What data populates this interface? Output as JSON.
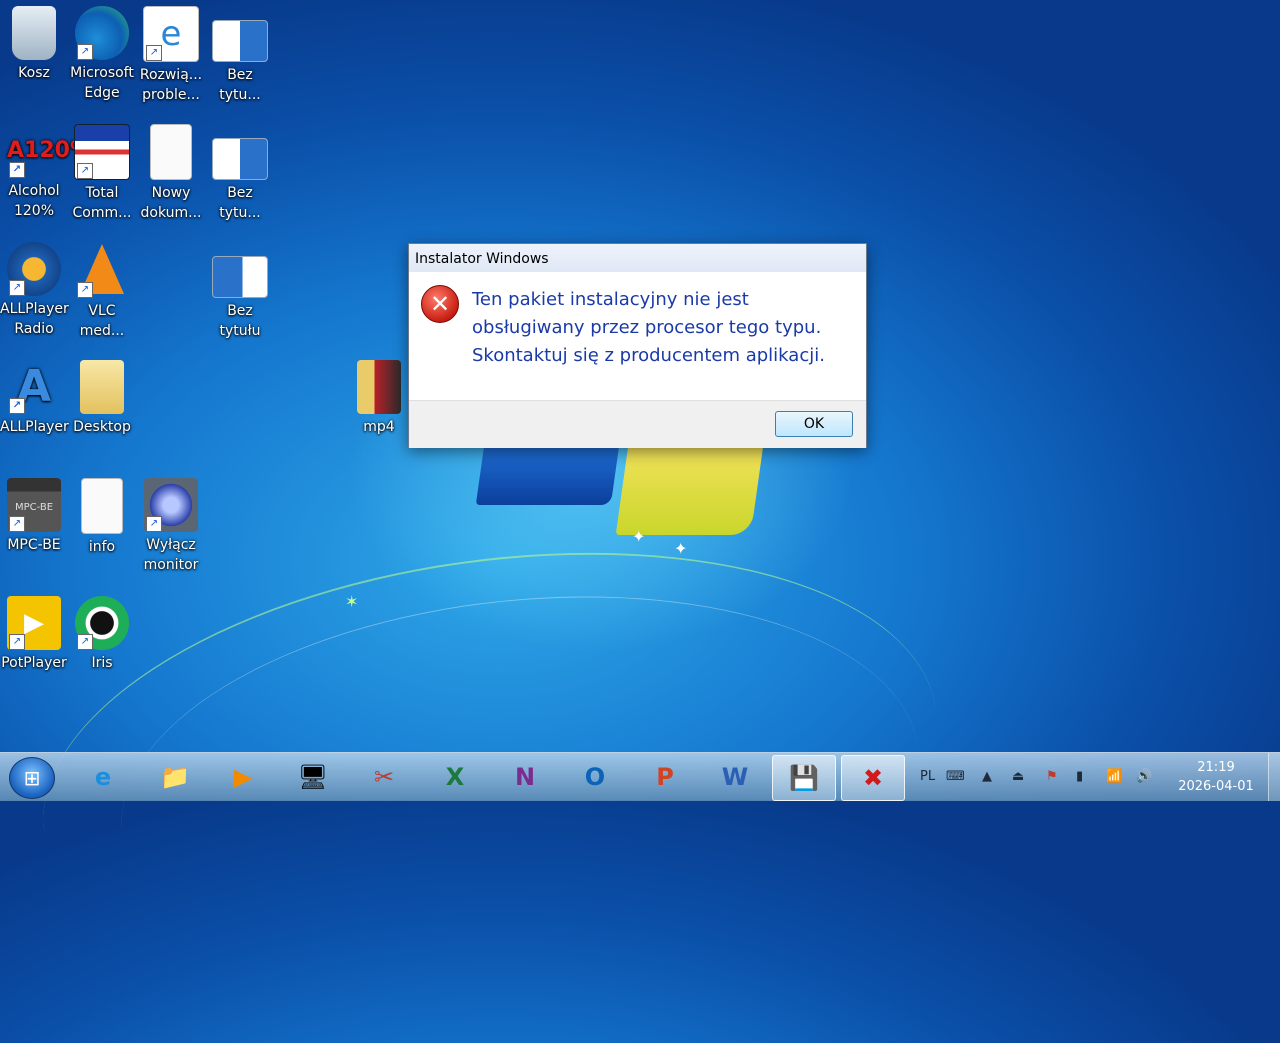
{
  "desktop": {
    "icons": [
      {
        "label": "Kosz"
      },
      {
        "label": "Microsoft Edge"
      },
      {
        "label": "Rozwią... proble..."
      },
      {
        "label": "Bez tytu..."
      },
      {
        "label": "Alcohol 120%"
      },
      {
        "label": "Total Comm..."
      },
      {
        "label": "Nowy dokum..."
      },
      {
        "label": "Bez tytu..."
      },
      {
        "label": "ALLPlayer Radio"
      },
      {
        "label": "VLC med..."
      },
      {
        "label": "Bez tytułu"
      },
      {
        "label": "ALLPlayer"
      },
      {
        "label": "Desktop"
      },
      {
        "label": "mp4"
      },
      {
        "label": "MPC-BE"
      },
      {
        "label": "info"
      },
      {
        "label": "Wyłącz monitor"
      },
      {
        "label": "PotPlayer"
      },
      {
        "label": "Iris"
      }
    ]
  },
  "dialog": {
    "title": "Instalator Windows",
    "message": "Ten pakiet instalacyjny nie jest obsługiwany przez procesor tego typu. Skontaktuj się z producentem aplikacji.",
    "ok_label": "OK"
  },
  "taskbar": {
    "start_glyph": "⊞",
    "buttons": [
      {
        "icon": "internet-explorer-icon",
        "glyph": "e"
      },
      {
        "icon": "file-explorer-icon",
        "glyph": "📁"
      },
      {
        "icon": "media-player-icon",
        "glyph": "▶"
      },
      {
        "icon": "monitor-icon",
        "glyph": "🖥"
      },
      {
        "icon": "tools-icon",
        "glyph": "✂"
      },
      {
        "icon": "excel-icon",
        "glyph": "X"
      },
      {
        "icon": "onenote-icon",
        "glyph": "N"
      },
      {
        "icon": "outlook-icon",
        "glyph": "O"
      },
      {
        "icon": "powerpoint-icon",
        "glyph": "P"
      },
      {
        "icon": "word-icon",
        "glyph": "W"
      },
      {
        "icon": "floppy-save-icon",
        "glyph": "💾"
      },
      {
        "icon": "error-icon",
        "glyph": "✖"
      }
    ],
    "language": "PL",
    "time": "21:19",
    "date": "2026-04-01"
  },
  "colors": {
    "dialog_text": "#1a3aa8",
    "error_red": "#c81f12",
    "wallpaper_blue": "#1578cf"
  }
}
